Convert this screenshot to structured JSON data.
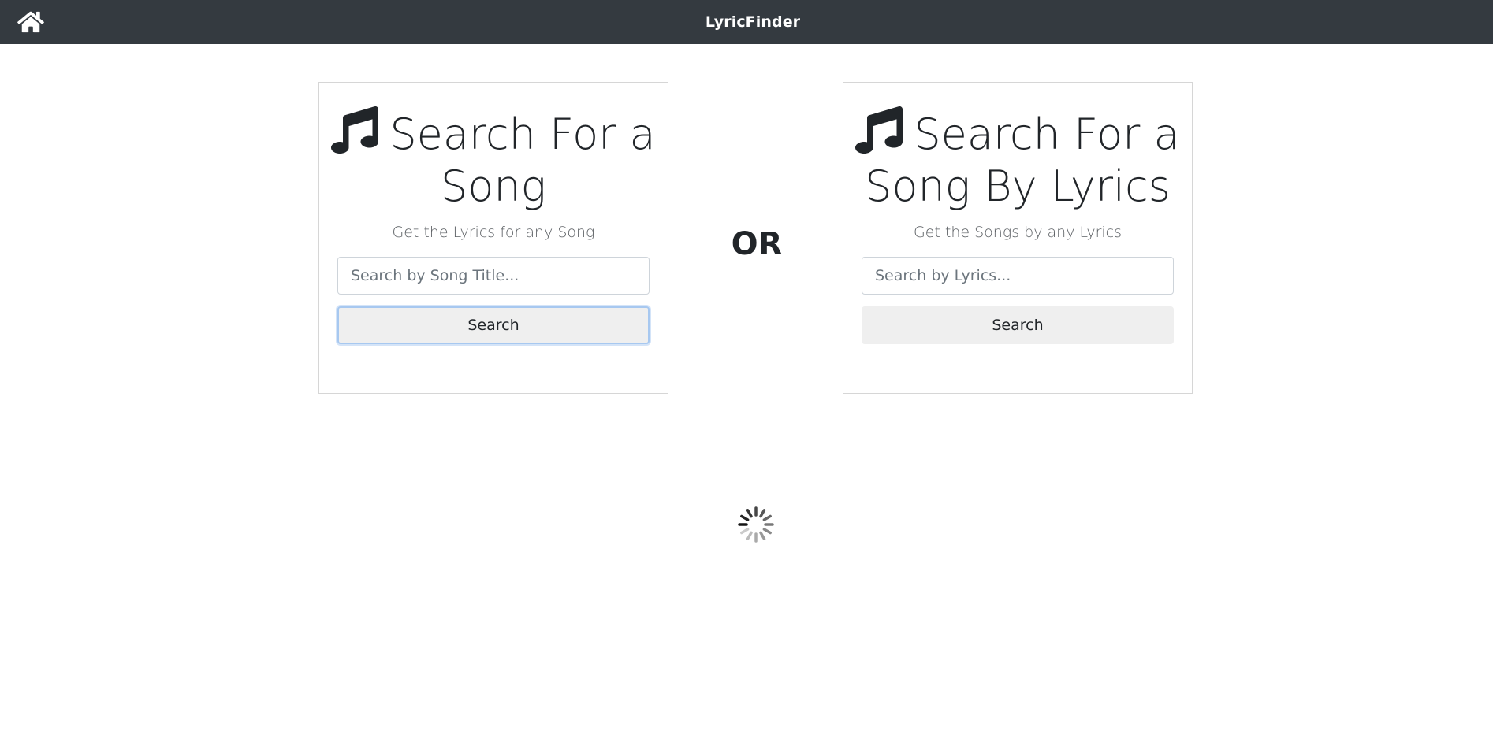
{
  "navbar": {
    "brand": "LyricFinder",
    "home_icon": "home-icon",
    "background": "#343a40"
  },
  "title_search": {
    "icon": "music-note-icon",
    "title": "Search For a Song",
    "subtitle": "Get the Lyrics for any Song",
    "input_value": "",
    "input_placeholder": "Search by Song Title...",
    "button_label": "Search"
  },
  "separator": {
    "label": "OR"
  },
  "lyrics_search": {
    "icon": "music-note-icon",
    "title": "Search For a Song By Lyrics",
    "subtitle": "Get the Songs by any Lyrics",
    "input_value": "",
    "input_placeholder": "Search by Lyrics...",
    "button_label": "Search"
  },
  "loading": {
    "icon": "loading-spinner-icon"
  }
}
